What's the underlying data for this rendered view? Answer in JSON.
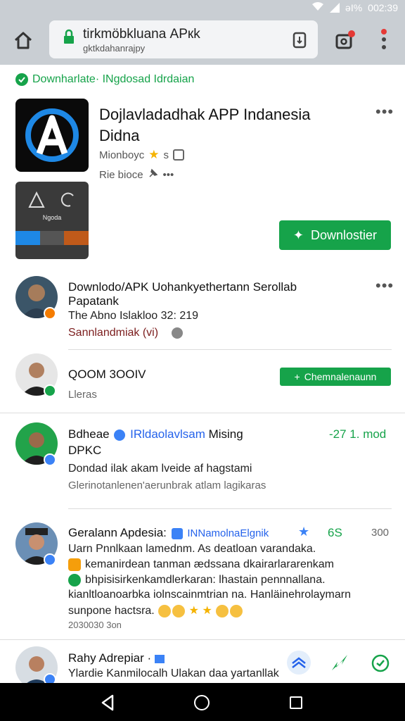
{
  "status_bar": {
    "battery_text": "əΙ%",
    "time": "002:39"
  },
  "browser": {
    "url_main": "tirkmöbkluаnа AРкk",
    "url_sub": "gktkdahanrajpy"
  },
  "banner": {
    "text": "Downharlate· INgdosad Idrdaian"
  },
  "app": {
    "title": "Dojlavladadhak APP Indanesia Didna",
    "meta_developer": "Mionboyc",
    "meta_rating_num": "s",
    "meta_second": "Rie bioce",
    "thumb_label": "Ngoda",
    "download_label": "Downlostier"
  },
  "feed": [
    {
      "title_line1": "Downlodo/APK Uohankyethertann Serollab",
      "title_line2": "Papatank",
      "info": "The Abno Islakloo 32: 219",
      "author": "Sannlandmiak (vi)"
    },
    {
      "title": "QOOM 3OOIV",
      "sub": "Lleras",
      "button_label": "Chemnalenaunn"
    },
    {
      "name": "Bdheae",
      "handle": "IRldaolavlsam",
      "name_suffix": "Mising",
      "name_line2": "DPKC",
      "score": "-27 1. mod",
      "text": "Dondad ilak akam lveide af hagstami",
      "sub": "Glerinotanlenen'aerunbrak atlam lagikaras"
    },
    {
      "name": "Geralann Apdesia:",
      "handle": "INNamolnaElgnik",
      "count_green": "6S",
      "count_gray": "300",
      "line1": "Uarn Pnnlkaan lamednm. As deatloan varandaka.",
      "line2": "kemanirdean tanman ædssana dkairarlararenkam",
      "line3": "bhpisisirkenkamdlerkaran: lhastain pennnallana.",
      "line4": "kianltloanoarbka iolnscainmtrian na. Hanläinehrolaymarn",
      "line5": "sunpone hactsra.",
      "date": "2030030 3on"
    },
    {
      "name": "Rahy Adrepiar ·",
      "text": "Ylardie Kanmilocalh Ulakan daa yartanllak"
    }
  ],
  "colors": {
    "accent_green": "#16a34a",
    "verified_blue": "#3b82f6",
    "star_yellow": "#f5b301"
  }
}
